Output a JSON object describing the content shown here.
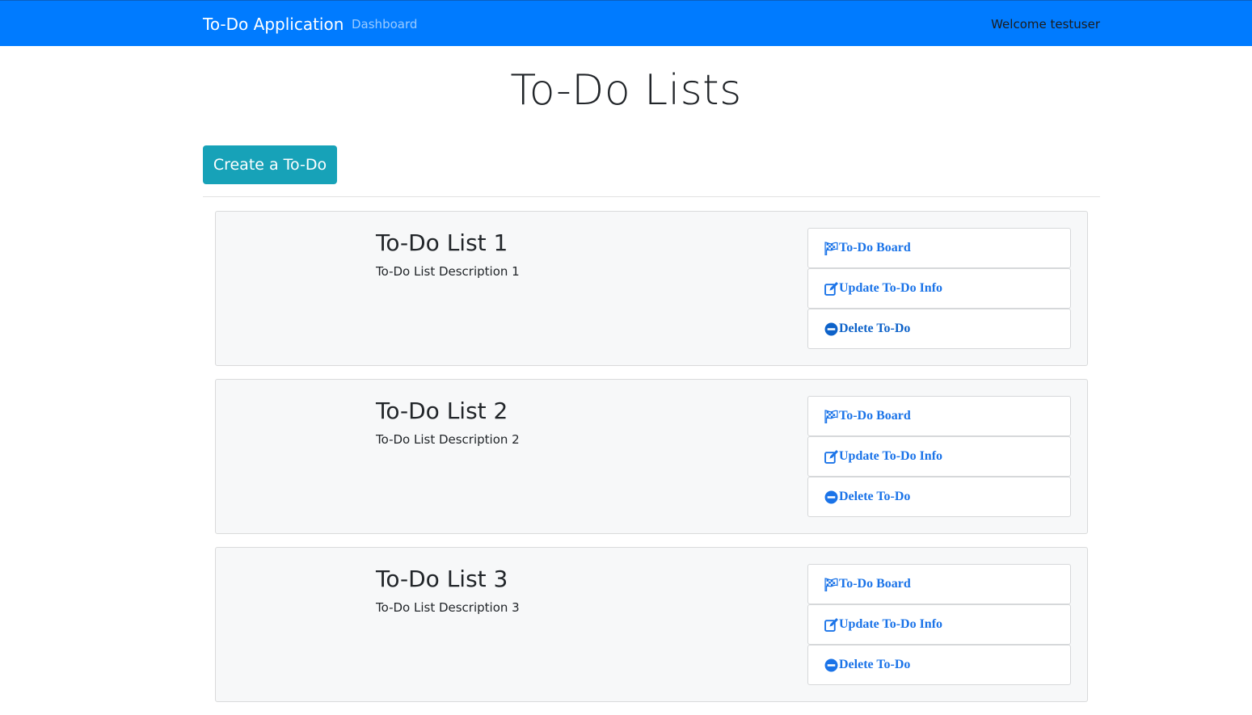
{
  "navbar": {
    "brand": "To-Do Application",
    "link": "Dashboard",
    "welcome": "Welcome testuser"
  },
  "page": {
    "title": "To-Do Lists",
    "create_button": "Create a To-Do"
  },
  "lists": [
    {
      "title": "To-Do List 1",
      "description": "To-Do List Description 1",
      "actions": {
        "board": "To-Do Board",
        "update": "Update To-Do Info",
        "delete": "Delete To-Do"
      }
    },
    {
      "title": "To-Do List 2",
      "description": "To-Do List Description 2",
      "actions": {
        "board": "To-Do Board",
        "update": "Update To-Do Info",
        "delete": "Delete To-Do"
      }
    },
    {
      "title": "To-Do List 3",
      "description": "To-Do List Description 3",
      "actions": {
        "board": "To-Do Board",
        "update": "Update To-Do Info",
        "delete": "Delete To-Do"
      }
    }
  ],
  "icons": {
    "board": "checkered-flag-icon",
    "update": "edit-icon",
    "delete": "minus-circle-icon"
  },
  "colors": {
    "navbar": "#007bff",
    "create_button": "#17a2b8",
    "action_text": "#1a73e8"
  }
}
